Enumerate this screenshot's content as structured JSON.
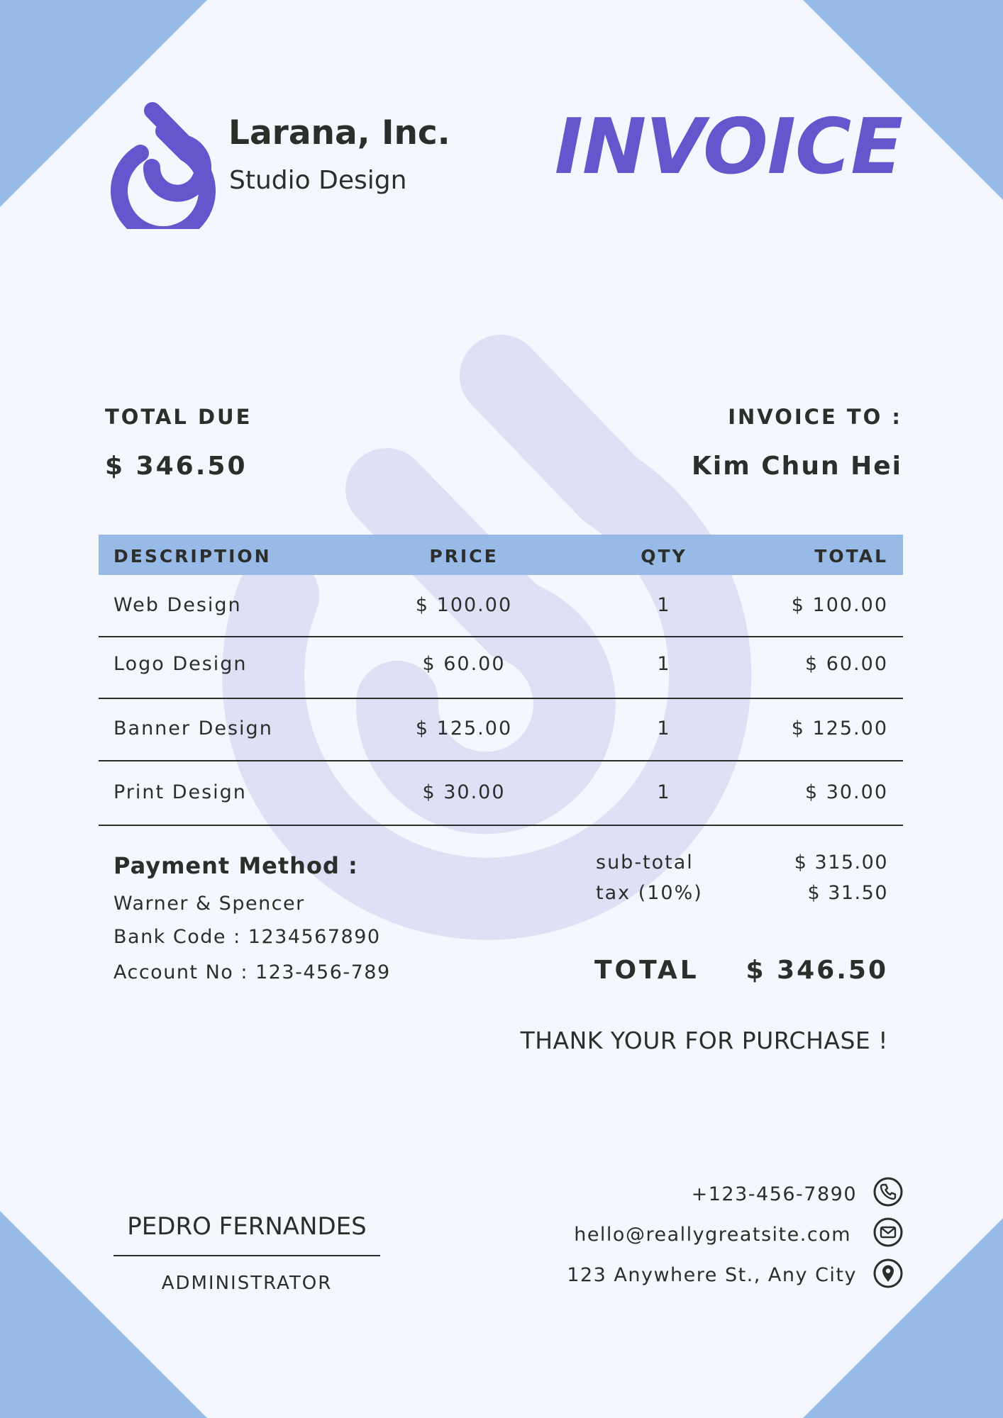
{
  "colors": {
    "background": "#f4f8fe",
    "corner": "#98bae7",
    "accent": "#6456cc",
    "watermark": "#dfdff5",
    "text": "#2b2e2a",
    "table_header": "#98bae7"
  },
  "company": {
    "logo_icon": "droplet-spiral-logo",
    "name": "Larana, Inc.",
    "subtitle": "Studio Design"
  },
  "document_title": "INVOICE",
  "summary": {
    "total_due_label": "TOTAL DUE",
    "total_due_value": "$ 346.50",
    "invoice_to_label": "INVOICE TO :",
    "client_name": "Kim Chun Hei"
  },
  "table": {
    "headers": [
      "DESCRIPTION",
      "PRICE",
      "QTY",
      "TOTAL"
    ],
    "rows": [
      [
        "Web Design",
        "$ 100.00",
        "1",
        "$ 100.00"
      ],
      [
        "Logo Design",
        "$ 60.00",
        "1",
        "$ 60.00"
      ],
      [
        "Banner Design",
        "$ 125.00",
        "1",
        "$ 125.00"
      ],
      [
        "Print Design",
        "$ 30.00",
        "1",
        "$ 30.00"
      ]
    ]
  },
  "payment": {
    "title": "Payment Method :",
    "bank": "Warner & Spencer",
    "bank_code": "Bank Code : 1234567890",
    "account_no": "Account No : 123-456-789"
  },
  "totals": {
    "subtotal_label": "sub-total",
    "subtotal_value": "$ 315.00",
    "tax_label": "tax (10%)",
    "tax_value": "$ 31.50",
    "total_label": "TOTAL",
    "total_value": "$ 346.50"
  },
  "thanks": "THANK YOUR FOR PURCHASE !",
  "signature": {
    "name": "PEDRO FERNANDES",
    "role": "ADMINISTRATOR"
  },
  "contact": {
    "phone": "+123-456-7890",
    "phone_icon": "phone-icon",
    "email": "hello@reallygreatsite.com",
    "email_icon": "mail-icon",
    "address": "123 Anywhere St., Any City",
    "address_icon": "location-pin-icon"
  }
}
